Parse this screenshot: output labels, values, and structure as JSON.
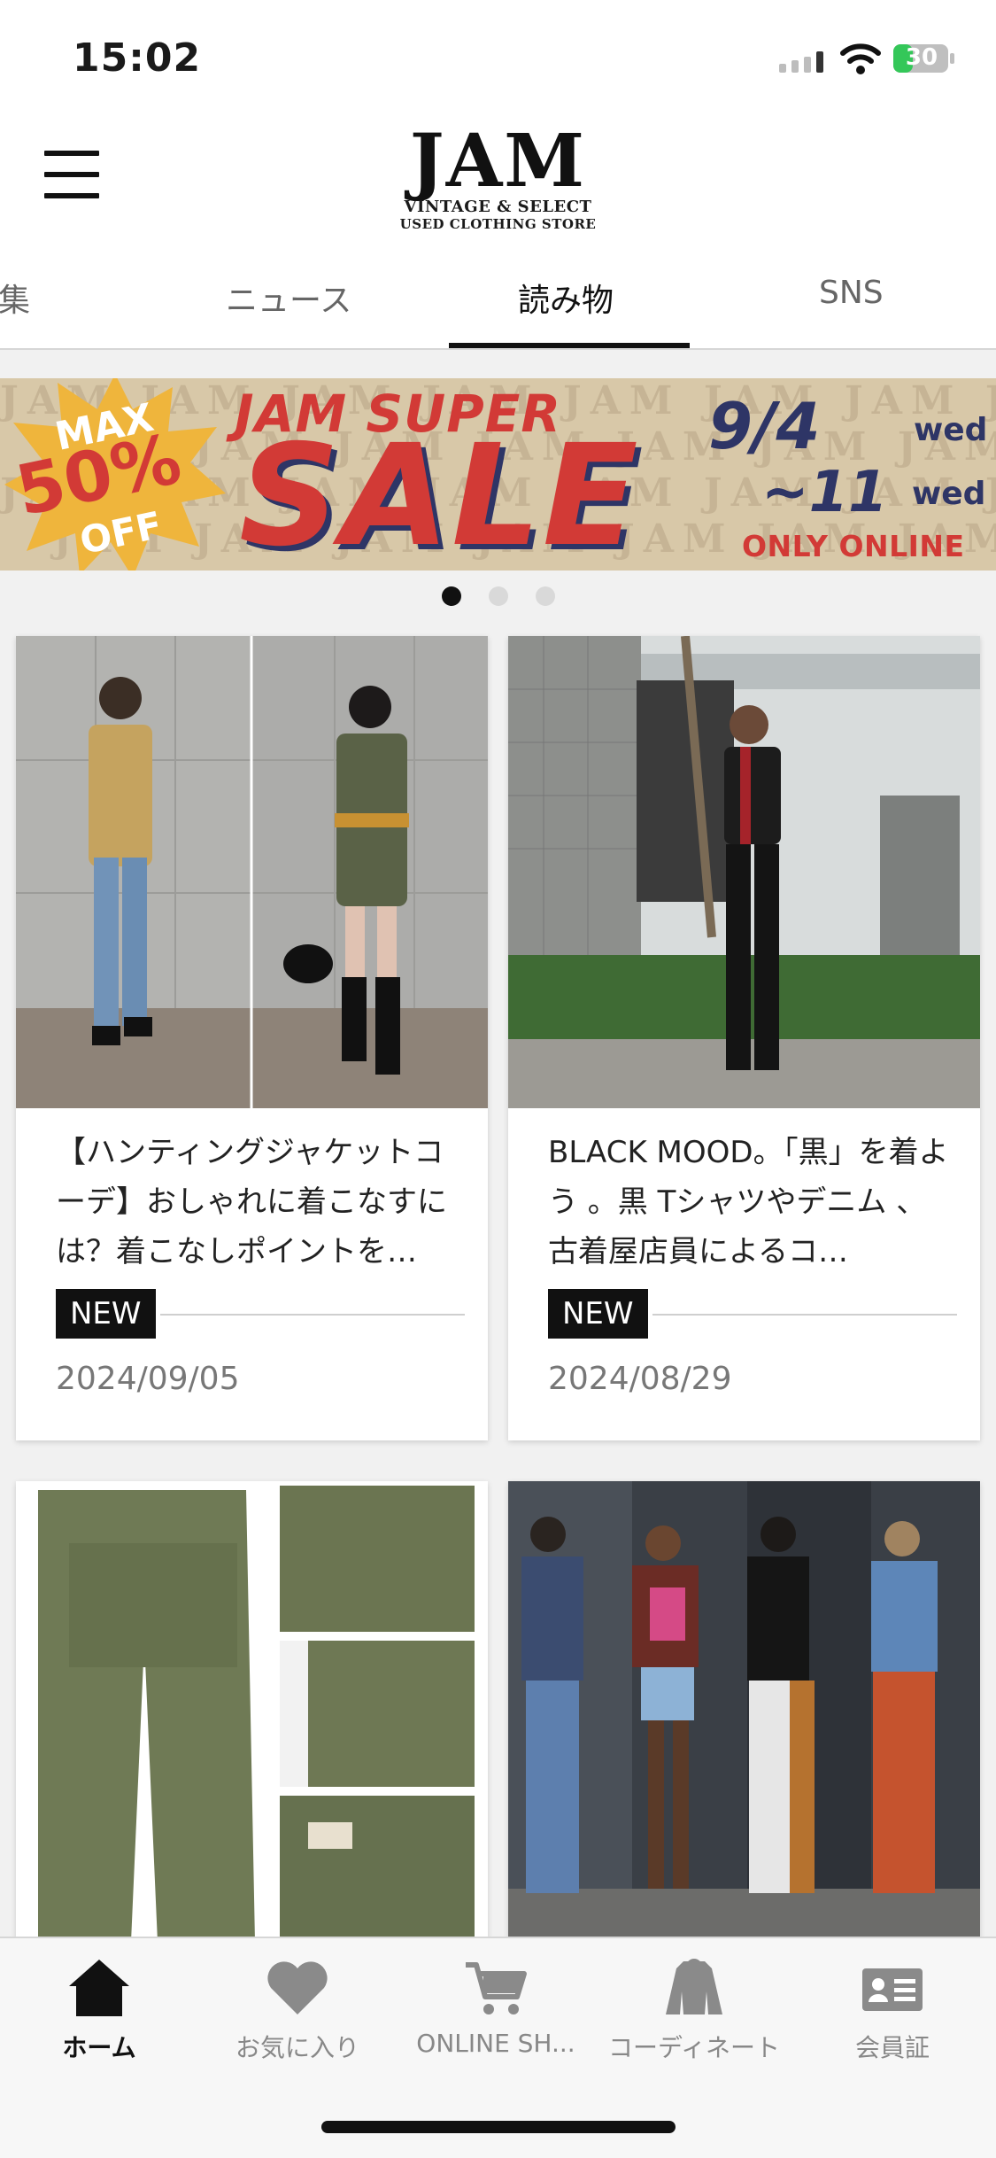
{
  "status_bar": {
    "time": "15:02",
    "battery": "30"
  },
  "header": {
    "logo_main": "JAM",
    "logo_sub1": "VINTAGE & SELECT",
    "logo_sub2": "USED CLOTHING STORE"
  },
  "tabs": [
    {
      "label": "集"
    },
    {
      "label": "ニュース"
    },
    {
      "label": "読み物",
      "active": true
    },
    {
      "label": "SNS"
    }
  ],
  "banner": {
    "max": "MAX",
    "percent": "50%",
    "off": "OFF",
    "title": "JAM SUPER",
    "sale": "SALE",
    "date1": "9/4",
    "wed1": "wed",
    "date2": "~11",
    "wed2": "wed",
    "only": "ONLY ONLINE",
    "watermark": "JAM JAM JAM JAM JAM JAM JAM JAM JAM JAM"
  },
  "carousel": {
    "pages": 3,
    "active": 0
  },
  "articles": [
    {
      "title": "【ハンティングジャケットコーデ】おしゃれに着こなすには？着こなしポイントを…",
      "badge": "NEW",
      "date": "2024/09/05"
    },
    {
      "title": "BLACK MOOD。「黒」を着よう 。黒 Tシャツやデニム 、古着屋店員によるコ…",
      "badge": "NEW",
      "date": "2024/08/29"
    }
  ],
  "bottom_nav": [
    {
      "label": "ホーム",
      "icon": "home-icon",
      "active": true
    },
    {
      "label": "お気に入り",
      "icon": "heart-icon"
    },
    {
      "label": "ONLINE SH...",
      "icon": "cart-icon"
    },
    {
      "label": "コーディネート",
      "icon": "jacket-icon"
    },
    {
      "label": "会員証",
      "icon": "member-card-icon"
    }
  ],
  "colors": {
    "accent": "#111111",
    "sale_red": "#d23a36",
    "sale_navy": "#2e3566",
    "banner_bg": "#d8c8a8"
  }
}
